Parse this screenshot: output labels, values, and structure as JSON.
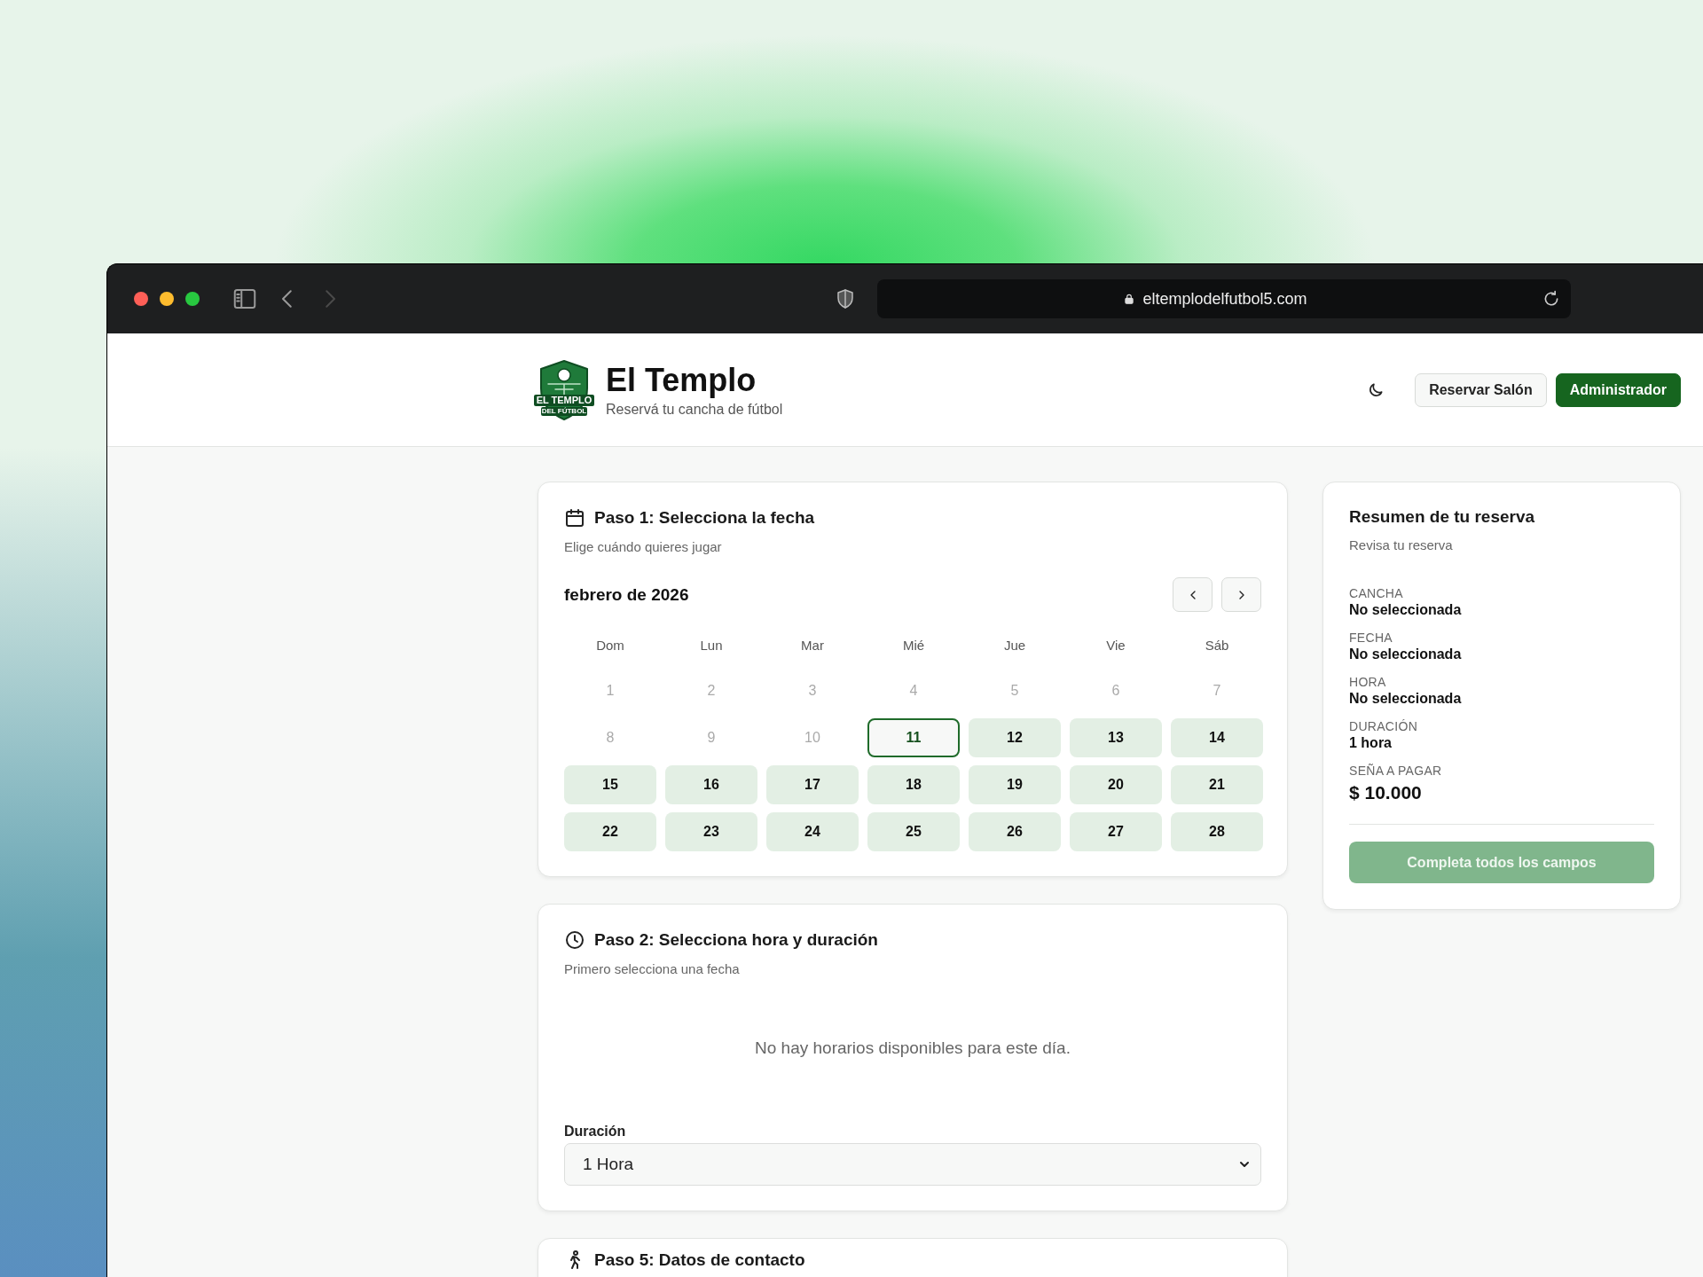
{
  "browser": {
    "nav": [
      {
        "kind": "sidebar",
        "disabled": false
      },
      {
        "kind": "back",
        "disabled": false
      },
      {
        "kind": "forward",
        "disabled": true
      }
    ],
    "url": "eltemplodelfutbol5.com"
  },
  "header": {
    "logo": {
      "line1": "EL TEMPLO",
      "line2": "DEL FÚTBOL"
    },
    "title": "El Templo",
    "subtitle": "Reservá tu cancha de fútbol",
    "buttons": [
      {
        "label": "Reservar Salón",
        "kind": "secondary"
      },
      {
        "label": "Administrador",
        "kind": "primary"
      }
    ]
  },
  "steps": [
    {
      "kind": "date",
      "title": "Paso 1: Selecciona la fecha",
      "subtitle": "Elige cuándo quieres jugar",
      "calendar": {
        "month": "febrero de 2026",
        "weekdays": [
          "Dom",
          "Lun",
          "Mar",
          "Mié",
          "Jue",
          "Vie",
          "Sáb"
        ],
        "days": [
          {
            "day": "1",
            "available": false,
            "today": false,
            "selected": false
          },
          {
            "day": "2",
            "available": false,
            "today": false,
            "selected": false
          },
          {
            "day": "3",
            "available": false,
            "today": false,
            "selected": false
          },
          {
            "day": "4",
            "available": false,
            "today": false,
            "selected": false
          },
          {
            "day": "5",
            "available": false,
            "today": false,
            "selected": false
          },
          {
            "day": "6",
            "available": false,
            "today": false,
            "selected": false
          },
          {
            "day": "7",
            "available": false,
            "today": false,
            "selected": false
          },
          {
            "day": "8",
            "available": false,
            "today": false,
            "selected": false
          },
          {
            "day": "9",
            "available": false,
            "today": false,
            "selected": false
          },
          {
            "day": "10",
            "available": false,
            "today": false,
            "selected": false
          },
          {
            "day": "11",
            "available": true,
            "today": true,
            "selected": false
          },
          {
            "day": "12",
            "available": true,
            "today": false,
            "selected": false
          },
          {
            "day": "13",
            "available": true,
            "today": false,
            "selected": false
          },
          {
            "day": "14",
            "available": true,
            "today": false,
            "selected": false
          },
          {
            "day": "15",
            "available": true,
            "today": false,
            "selected": false
          },
          {
            "day": "16",
            "available": true,
            "today": false,
            "selected": false
          },
          {
            "day": "17",
            "available": true,
            "today": false,
            "selected": false
          },
          {
            "day": "18",
            "available": true,
            "today": false,
            "selected": false
          },
          {
            "day": "19",
            "available": true,
            "today": false,
            "selected": false
          },
          {
            "day": "20",
            "available": true,
            "today": false,
            "selected": false
          },
          {
            "day": "21",
            "available": true,
            "today": false,
            "selected": false
          },
          {
            "day": "22",
            "available": true,
            "today": false,
            "selected": false
          },
          {
            "day": "23",
            "available": true,
            "today": false,
            "selected": false
          },
          {
            "day": "24",
            "available": true,
            "today": false,
            "selected": false
          },
          {
            "day": "25",
            "available": true,
            "today": false,
            "selected": false
          },
          {
            "day": "26",
            "available": true,
            "today": false,
            "selected": false
          },
          {
            "day": "27",
            "available": true,
            "today": false,
            "selected": false
          },
          {
            "day": "28",
            "available": true,
            "today": false,
            "selected": false
          }
        ]
      }
    },
    {
      "kind": "time",
      "title": "Paso 2: Selecciona hora y duración",
      "subtitle": "Primero selecciona una fecha",
      "message": "No hay horarios disponibles para este día.",
      "duration": {
        "label": "Duración",
        "value": "1 Hora"
      }
    },
    {
      "kind": "contact",
      "title": "Paso 5: Datos de contacto"
    }
  ],
  "summary": {
    "title": "Resumen de tu reserva",
    "subtitle": "Revisa tu reserva",
    "fields": [
      {
        "label": "CANCHA",
        "value": "No seleccionada",
        "kind": "text"
      },
      {
        "label": "FECHA",
        "value": "No seleccionada",
        "kind": "text"
      },
      {
        "label": "HORA",
        "value": "No seleccionada",
        "kind": "text"
      },
      {
        "label": "DURACIÓN",
        "value": "1 hora",
        "kind": "text"
      },
      {
        "label": "SEÑA A PAGAR",
        "value": "$ 10.000",
        "kind": "price"
      }
    ],
    "button": {
      "label": "Completa todos los campos",
      "disabled": true
    }
  }
}
